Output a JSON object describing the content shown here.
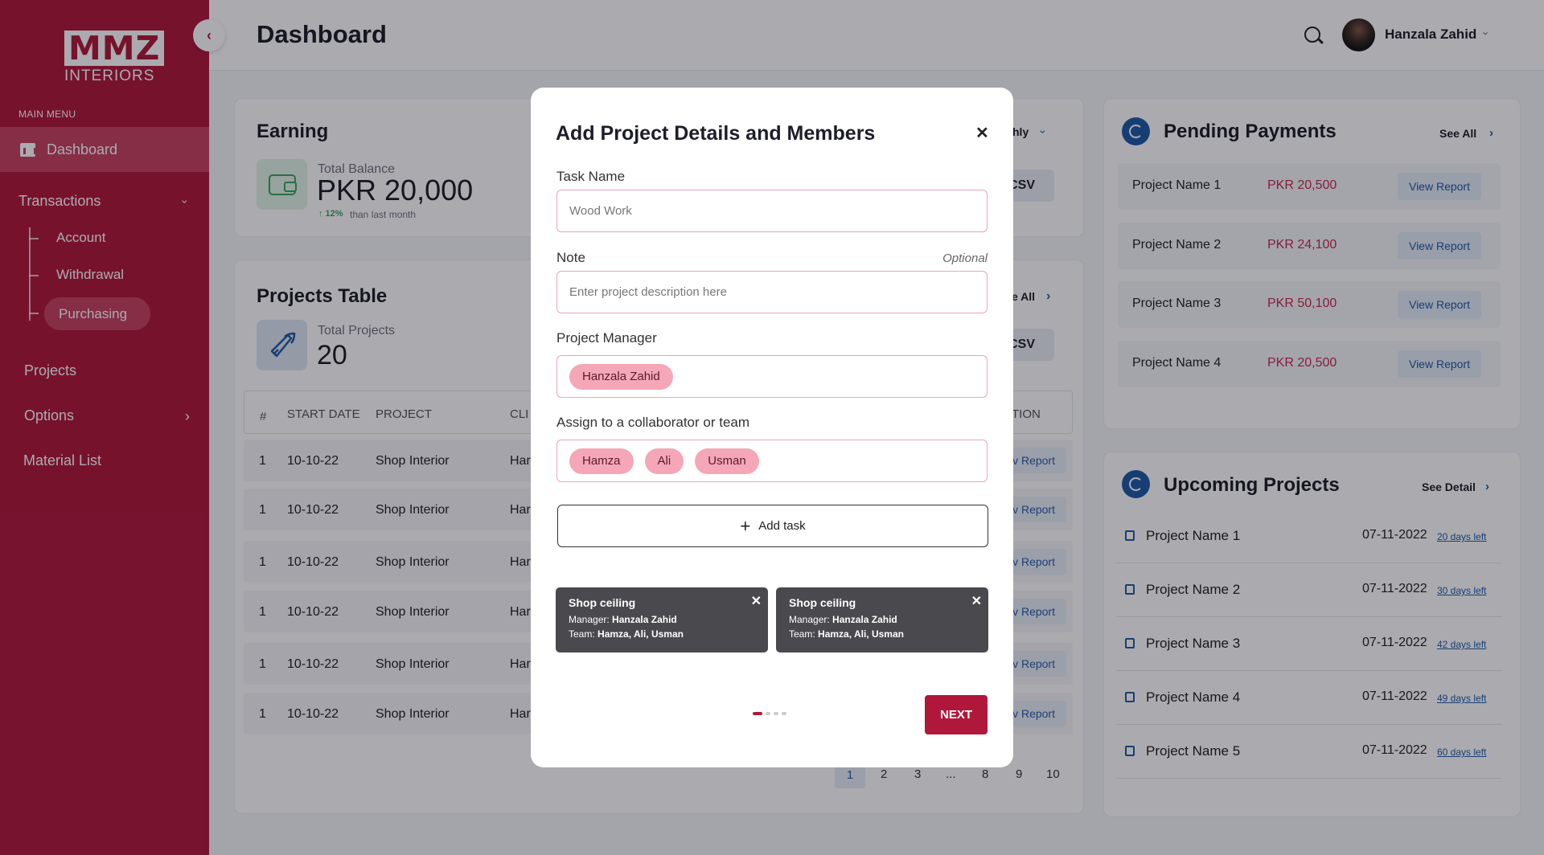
{
  "sidebar": {
    "logo_top": "MMZ",
    "logo_bottom": "INTERIORS",
    "menu_title": "MAIN MENU",
    "active_item": "Dashboard",
    "transactions": "Transactions",
    "sub_items": [
      "Account",
      "Withdrawal",
      "Purchasing"
    ],
    "projects": "Projects",
    "options": "Options",
    "material_list": "Material List"
  },
  "header": {
    "title": "Dashboard",
    "user_name": "Hanzala Zahid"
  },
  "earning": {
    "title": "Earning",
    "balance_label": "Total Balance",
    "balance_value": "PKR 20,000",
    "change": "↑ 12%",
    "change_text": "than last month",
    "period": "hly",
    "csv": "CSV"
  },
  "projects_table": {
    "title": "Projects Table",
    "total_label": "Total Projects",
    "total_value": "20",
    "see_all": "e All",
    "csv": "CSV",
    "columns": [
      "#",
      "START DATE",
      "PROJECT",
      "CLI",
      "TION"
    ],
    "rows": [
      {
        "num": "1",
        "date": "10-10-22",
        "project": "Shop Interior",
        "client": "Har",
        "action": "v Report"
      },
      {
        "num": "1",
        "date": "10-10-22",
        "project": "Shop Interior",
        "client": "Har",
        "action": "v Report"
      },
      {
        "num": "1",
        "date": "10-10-22",
        "project": "Shop Interior",
        "client": "Har",
        "action": "v Report"
      },
      {
        "num": "1",
        "date": "10-10-22",
        "project": "Shop Interior",
        "client": "Har",
        "action": "v Report"
      },
      {
        "num": "1",
        "date": "10-10-22",
        "project": "Shop Interior",
        "client": "Har",
        "action": "v Report"
      },
      {
        "num": "1",
        "date": "10-10-22",
        "project": "Shop Interior",
        "client": "Har",
        "action": "v Report"
      }
    ],
    "pagination": [
      "1",
      "2",
      "3",
      "...",
      "8",
      "9",
      "10"
    ]
  },
  "pending_payments": {
    "title": "Pending Payments",
    "see_all": "See All",
    "items": [
      {
        "name": "Project Name 1",
        "amount": "PKR 20,500",
        "action": "View Report"
      },
      {
        "name": "Project Name 2",
        "amount": "PKR 24,100",
        "action": "View Report"
      },
      {
        "name": "Project Name 3",
        "amount": "PKR 50,100",
        "action": "View Report"
      },
      {
        "name": "Project Name 4",
        "amount": "PKR 20,500",
        "action": "View Report"
      }
    ]
  },
  "upcoming_projects": {
    "title": "Upcoming Projects",
    "see_detail": "See Detail",
    "items": [
      {
        "name": "Project Name 1",
        "date": "07-11-2022",
        "left": "20 days left"
      },
      {
        "name": "Project Name 2",
        "date": "07-11-2022",
        "left": "30 days left"
      },
      {
        "name": "Project Name 3",
        "date": "07-11-2022",
        "left": "42 days left"
      },
      {
        "name": "Project Name 4",
        "date": "07-11-2022",
        "left": "49 days left"
      },
      {
        "name": "Project Name 5",
        "date": "07-11-2022",
        "left": "60 days left"
      }
    ]
  },
  "modal": {
    "title": "Add Project Details and Members",
    "task_name_label": "Task Name",
    "task_name_placeholder": "Wood Work",
    "note_label": "Note",
    "note_optional": "Optional",
    "note_placeholder": "Enter project description here",
    "manager_label": "Project Manager",
    "manager_chip": "Hanzala Zahid",
    "assign_label": "Assign to a collaborator or team",
    "team_chips": [
      "Hamza",
      "Ali",
      "Usman"
    ],
    "add_task": "Add task",
    "tasks": [
      {
        "title": "Shop ceiling",
        "manager_label": "Manager:",
        "manager": "Hanzala Zahid",
        "team_label": "Team:",
        "team": "Hamza, Ali, Usman"
      },
      {
        "title": "Shop ceiling",
        "manager_label": "Manager:",
        "manager": "Hanzala Zahid",
        "team_label": "Team:",
        "team": "Hamza, Ali, Usman"
      }
    ],
    "next": "NEXT",
    "step_current": 1,
    "step_total": 4
  },
  "colors": {
    "brand": "#b0183b",
    "brand_light": "#c64260",
    "accent_blue": "#1f5aa6",
    "amount_red": "#c8284e",
    "chip_pink": "#f5a7b7"
  }
}
